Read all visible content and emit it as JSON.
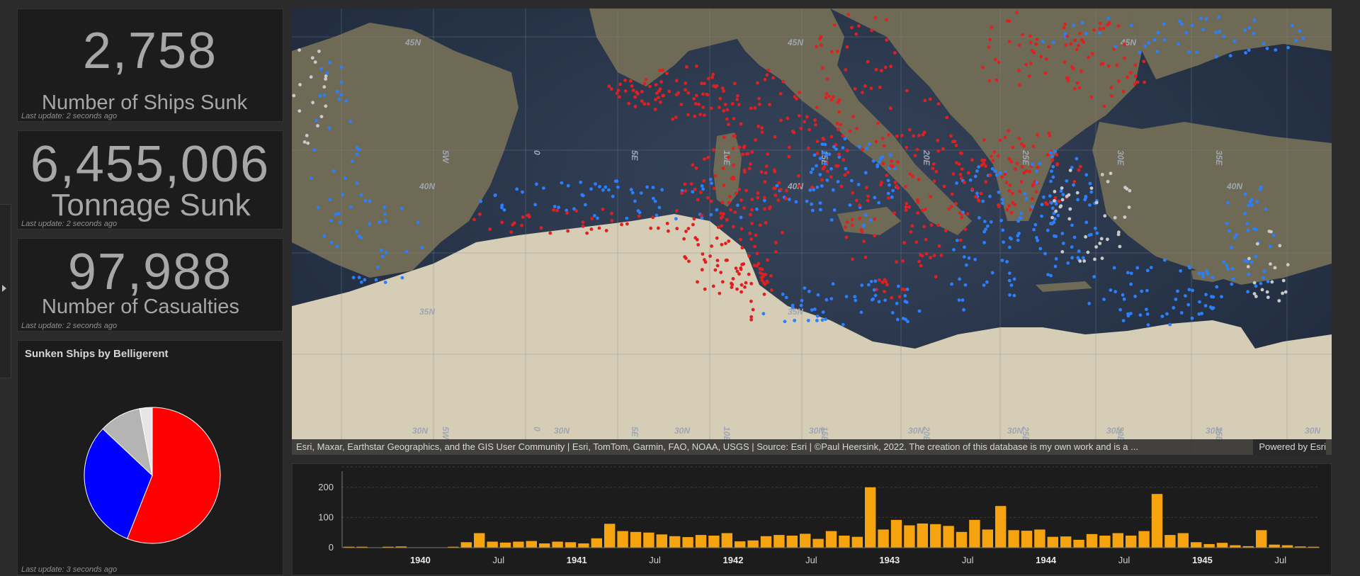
{
  "cards": {
    "ships": {
      "value": "2,758",
      "label": "Number of Ships Sunk",
      "updated": "Last update: 2 seconds ago"
    },
    "tonnage": {
      "value": "6,455,006",
      "label": "Tonnage Sunk",
      "updated": "Last update: 2 seconds ago"
    },
    "casualties": {
      "value": "97,988",
      "label": "Number of Casualties",
      "updated": "Last update: 2 seconds ago"
    }
  },
  "pie_card": {
    "title": "Sunken Ships by Belligerent",
    "updated": "Last update: 3 seconds ago"
  },
  "map": {
    "attribution": "Esri, Maxar, Earthstar Geographics, and the GIS User Community | Esri, TomTom, Garmin, FAO, NOAA, USGS | Source: Esri | ©Paul Heersink, 2022. The creation of this database is my own work and is a ...",
    "powered_by": "Powered by Esri",
    "lat_labels": [
      "45N",
      "40N",
      "35N",
      "30N"
    ],
    "lon_labels": [
      "5W",
      "0",
      "5E",
      "10E",
      "15E",
      "20E",
      "25E",
      "30E",
      "35E"
    ],
    "colors": {
      "axis": "#e02020",
      "allied": "#2a7fff",
      "neutral": "#c9c9c9"
    }
  },
  "chart_data": [
    {
      "type": "pie",
      "title": "Sunken Ships by Belligerent",
      "series": [
        {
          "value": 56,
          "color": "#ff0000"
        },
        {
          "value": 31,
          "color": "#0000ff"
        },
        {
          "value": 10,
          "color": "#b4b4b4"
        },
        {
          "value": 3,
          "color": "#e6e6e6"
        }
      ]
    },
    {
      "type": "bar",
      "color": "#f5a30f",
      "ylim": [
        0,
        230
      ],
      "yticks": [
        0,
        100,
        200
      ],
      "x_tick_labels": [
        {
          "month": 6,
          "label": "1940",
          "bold": true
        },
        {
          "month": 12,
          "label": "Jul",
          "bold": false
        },
        {
          "month": 18,
          "label": "1941",
          "bold": true
        },
        {
          "month": 24,
          "label": "Jul",
          "bold": false
        },
        {
          "month": 30,
          "label": "1942",
          "bold": true
        },
        {
          "month": 36,
          "label": "Jul",
          "bold": false
        },
        {
          "month": 42,
          "label": "1943",
          "bold": true
        },
        {
          "month": 48,
          "label": "Jul",
          "bold": false
        },
        {
          "month": 54,
          "label": "1944",
          "bold": true
        },
        {
          "month": 60,
          "label": "Jul",
          "bold": false
        },
        {
          "month": 66,
          "label": "1945",
          "bold": true
        },
        {
          "month": 72,
          "label": "Jul",
          "bold": false
        }
      ],
      "values": [
        3,
        3,
        1,
        3,
        4,
        0,
        0,
        0,
        3,
        18,
        48,
        20,
        17,
        20,
        22,
        14,
        20,
        18,
        14,
        31,
        79,
        55,
        52,
        50,
        44,
        38,
        35,
        42,
        40,
        48,
        21,
        24,
        38,
        42,
        40,
        46,
        29,
        55,
        40,
        36,
        200,
        60,
        92,
        74,
        80,
        78,
        72,
        52,
        92,
        60,
        138,
        58,
        56,
        60,
        36,
        37,
        26,
        45,
        40,
        48,
        40,
        55,
        178,
        42,
        48,
        18,
        12,
        16,
        8,
        5,
        58,
        10,
        8,
        4,
        3
      ]
    }
  ]
}
